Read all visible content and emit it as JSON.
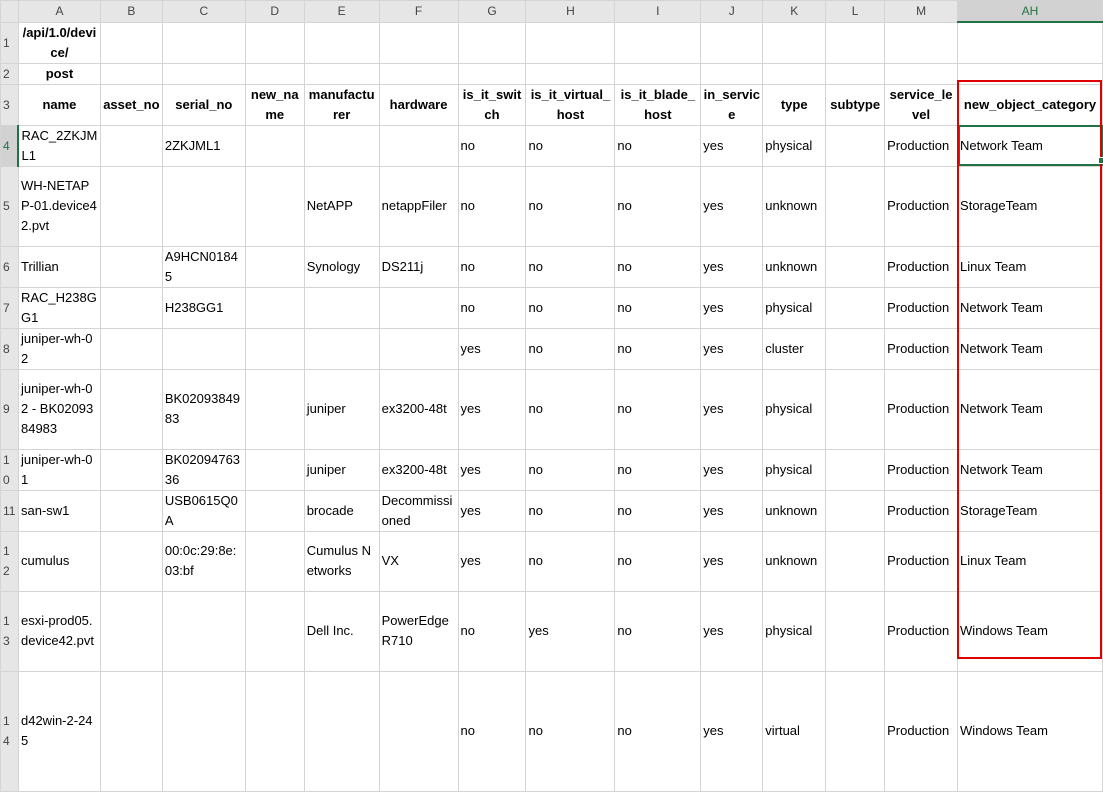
{
  "columns": [
    "A",
    "B",
    "C",
    "D",
    "E",
    "F",
    "G",
    "H",
    "I",
    "J",
    "K",
    "L",
    "M",
    "AH"
  ],
  "selected_column": "AH",
  "title_row": {
    "row_num": "1",
    "text": "/api/1.0/device/"
  },
  "subtitle_row": {
    "row_num": "2",
    "text": "post"
  },
  "header_row": {
    "row_num": "3",
    "cells": [
      "name",
      "asset_no",
      "serial_no",
      "new_name",
      "manufacturer",
      "hardware",
      "is_it_switch",
      "is_it_virtual_host",
      "is_it_blade_host",
      "in_service",
      "type",
      "subtype",
      "service_level",
      "new_object_category"
    ]
  },
  "rows": [
    {
      "row_num": "4",
      "cells": [
        "RAC_2ZKJML1",
        "",
        "2ZKJML1",
        "",
        "",
        "",
        "no",
        "no",
        "no",
        "yes",
        "physical",
        "",
        "Production",
        "Network Team"
      ]
    },
    {
      "row_num": "5",
      "cells": [
        "WH-NETAPP-01.device42.pvt",
        "",
        "",
        "",
        "NetAPP",
        "netappFiler",
        "no",
        "no",
        "no",
        "yes",
        "unknown",
        "",
        "Production",
        "StorageTeam"
      ]
    },
    {
      "row_num": "6",
      "cells": [
        "Trillian",
        "",
        "A9HCN01845",
        "",
        "Synology",
        "DS211j",
        "no",
        "no",
        "no",
        "yes",
        "unknown",
        "",
        "Production",
        "Linux Team"
      ]
    },
    {
      "row_num": "7",
      "cells": [
        "RAC_H238GG1",
        "",
        "H238GG1",
        "",
        "",
        "",
        "no",
        "no",
        "no",
        "yes",
        "physical",
        "",
        "Production",
        "Network Team"
      ]
    },
    {
      "row_num": "8",
      "cells": [
        "juniper-wh-02",
        "",
        "",
        "",
        "",
        "",
        "yes",
        "no",
        "no",
        "yes",
        "cluster",
        "",
        "Production",
        "Network Team"
      ]
    },
    {
      "row_num": "9",
      "cells": [
        "juniper-wh-02 - BK0209384983",
        "",
        "BK0209384983",
        "",
        "juniper",
        "ex3200-48t",
        "yes",
        "no",
        "no",
        "yes",
        "physical",
        "",
        "Production",
        "Network Team"
      ]
    },
    {
      "row_num": "10",
      "cells": [
        "juniper-wh-01",
        "",
        "BK0209476336",
        "",
        "juniper",
        "ex3200-48t",
        "yes",
        "no",
        "no",
        "yes",
        "physical",
        "",
        "Production",
        "Network Team"
      ]
    },
    {
      "row_num": "11",
      "cells": [
        "san-sw1",
        "",
        "USB0615Q0A",
        "",
        "brocade",
        "Decommissioned",
        "yes",
        "no",
        "no",
        "yes",
        "unknown",
        "",
        "Production",
        "StorageTeam"
      ]
    },
    {
      "row_num": "12",
      "cells": [
        "cumulus",
        "",
        "00:0c:29:8e:03:bf",
        "",
        "Cumulus Networks",
        "VX",
        "yes",
        "no",
        "no",
        "yes",
        "unknown",
        "",
        "Production",
        "Linux Team"
      ]
    },
    {
      "row_num": "13",
      "cells": [
        "esxi-prod05.device42.pvt",
        "",
        "",
        "",
        "Dell Inc.",
        "PowerEdge R710",
        "no",
        "yes",
        "no",
        "yes",
        "physical",
        "",
        "Production",
        "Windows Team"
      ]
    },
    {
      "row_num": "14",
      "cells": [
        "d42win-2-245",
        "",
        "",
        "",
        "",
        "",
        "no",
        "no",
        "no",
        "yes",
        "virtual",
        "",
        "Production",
        "Windows Team"
      ]
    }
  ],
  "accent_color": "#217346",
  "highlight_color": "#e00000"
}
